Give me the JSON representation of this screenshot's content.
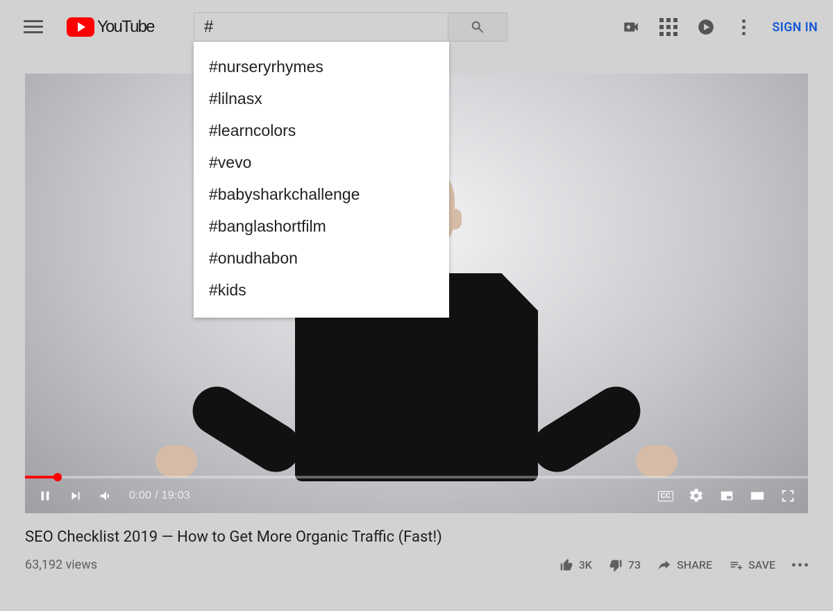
{
  "header": {
    "brand_text": "YouTube",
    "sign_in_label": "SIGN IN"
  },
  "search": {
    "value": "#",
    "suggestions": [
      "#nurseryrhymes",
      "#lilnasx",
      "#learncolors",
      "#vevo",
      "#babysharkchallenge",
      "#banglashortfilm",
      "#onudhabon",
      "#kids"
    ]
  },
  "player": {
    "current_time": "0:00",
    "duration": "19:03",
    "cc_label": "CC"
  },
  "video": {
    "title": "SEO Checklist 2019 — How to Get More Organic Traffic (Fast!)",
    "views_text": "63,192 views",
    "likes_text": "3K",
    "dislikes_text": "73",
    "share_label": "SHARE",
    "save_label": "SAVE"
  }
}
